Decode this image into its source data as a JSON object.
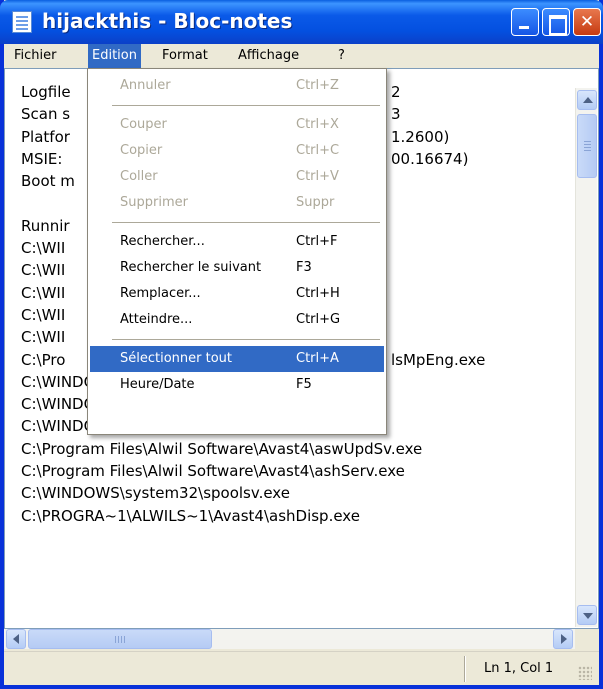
{
  "window": {
    "title": "hijackthis - Bloc-notes"
  },
  "menubar": {
    "items": [
      "Fichier",
      "Edition",
      "Format",
      "Affichage",
      "?"
    ],
    "active": "Edition"
  },
  "editor": {
    "lines": [
      "Logfile",
      "Scan s",
      "Platfor",
      "MSIE:",
      "Boot m",
      "",
      "Runnir",
      "C:\\WII",
      "C:\\WII",
      "C:\\WII",
      "C:\\WII",
      "C:\\WII",
      "C:\\Pro",
      "C:\\WINDOWS\\system32\\svchost.exe",
      "C:\\WINDOWS\\system32\\svchost.exe",
      "C:\\WINDOWS\\system32\\ZoneLabs\\vsmon.exe",
      "C:\\Program Files\\Alwil Software\\Avast4\\aswUpdSv.exe",
      "C:\\Program Files\\Alwil Software\\Avast4\\ashServ.exe",
      "C:\\WINDOWS\\system32\\spoolsv.exe",
      "C:\\PROGRA~1\\ALWILS~1\\Avast4\\ashDisp.exe"
    ],
    "partial_right": [
      "2",
      "3",
      "1.2600)",
      "00.16674)",
      "",
      "",
      "",
      "",
      "",
      "",
      "",
      "",
      "lsMpEng.exe"
    ]
  },
  "edit_menu": {
    "items": [
      {
        "label": "Annuler",
        "shortcut": "Ctrl+Z",
        "disabled": true
      },
      {
        "sep": true
      },
      {
        "label": "Couper",
        "shortcut": "Ctrl+X",
        "disabled": true
      },
      {
        "label": "Copier",
        "shortcut": "Ctrl+C",
        "disabled": true
      },
      {
        "label": "Coller",
        "shortcut": "Ctrl+V",
        "disabled": true
      },
      {
        "label": "Supprimer",
        "shortcut": "Suppr",
        "disabled": true
      },
      {
        "sep": true
      },
      {
        "label": "Rechercher...",
        "shortcut": "Ctrl+F",
        "disabled": false
      },
      {
        "label": "Rechercher le suivant",
        "shortcut": "F3",
        "disabled": false
      },
      {
        "label": "Remplacer...",
        "shortcut": "Ctrl+H",
        "disabled": false
      },
      {
        "label": "Atteindre...",
        "shortcut": "Ctrl+G",
        "disabled": false
      },
      {
        "sep": true
      },
      {
        "label": "Sélectionner tout",
        "shortcut": "Ctrl+A",
        "disabled": false,
        "selected": true
      },
      {
        "label": "Heure/Date",
        "shortcut": "F5",
        "disabled": false
      }
    ]
  },
  "statusbar": {
    "position": "Ln 1, Col 1"
  },
  "colors": {
    "titlebar": "#0a5ae8",
    "highlight": "#316ac5",
    "disabled_text": "#aca899"
  }
}
